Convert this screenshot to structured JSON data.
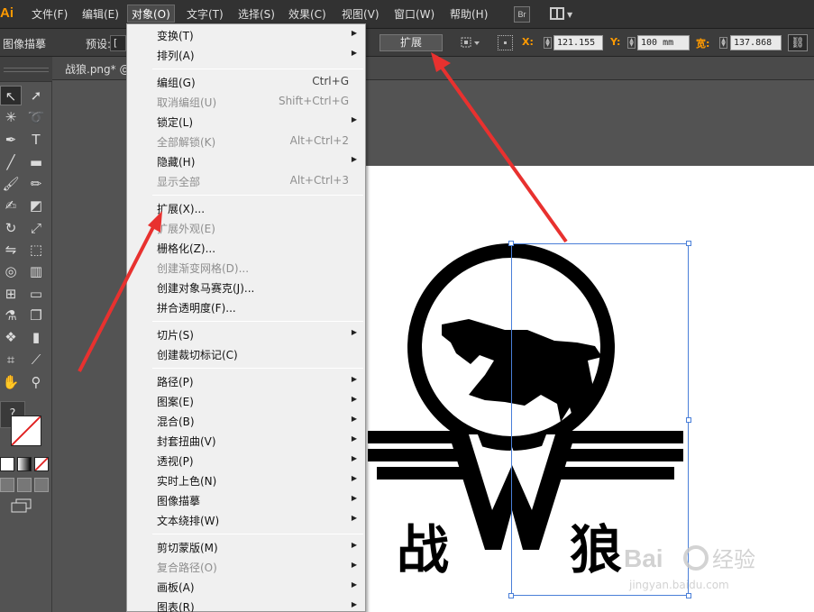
{
  "app": {
    "logo": "Ai",
    "menus": [
      "文件(F)",
      "编辑(E)",
      "对象(O)",
      "文字(T)",
      "选择(S)",
      "效果(C)",
      "视图(V)",
      "窗口(W)",
      "帮助(H)"
    ],
    "active_menu": "对象(O)",
    "bridge_label": "Br",
    "workspace_icon": "workspace-switcher-icon"
  },
  "control_bar": {
    "panel_name": "图像描摹",
    "preset_label": "预设:",
    "preset_value": "[",
    "expand_button": "扩展",
    "x_label": "X:",
    "x_value": "121.155",
    "y_label": "Y:",
    "y_value": "100 mm",
    "w_label": "宽:",
    "w_value": "137.868"
  },
  "document": {
    "tab_title": "战狼.png* @"
  },
  "object_menu": {
    "items": [
      {
        "label": "变换(T)",
        "shortcut": "",
        "submenu": true,
        "disabled": false
      },
      {
        "label": "排列(A)",
        "shortcut": "",
        "submenu": true,
        "disabled": false
      },
      {
        "label": "编组(G)",
        "shortcut": "Ctrl+G",
        "submenu": false,
        "disabled": false
      },
      {
        "label": "取消编组(U)",
        "shortcut": "Shift+Ctrl+G",
        "submenu": false,
        "disabled": true
      },
      {
        "label": "锁定(L)",
        "shortcut": "",
        "submenu": true,
        "disabled": false
      },
      {
        "label": "全部解锁(K)",
        "shortcut": "Alt+Ctrl+2",
        "submenu": false,
        "disabled": true
      },
      {
        "label": "隐藏(H)",
        "shortcut": "",
        "submenu": true,
        "disabled": false
      },
      {
        "label": "显示全部",
        "shortcut": "Alt+Ctrl+3",
        "submenu": false,
        "disabled": true
      },
      {
        "label": "扩展(X)...",
        "shortcut": "",
        "submenu": false,
        "disabled": false
      },
      {
        "label": "扩展外观(E)",
        "shortcut": "",
        "submenu": false,
        "disabled": true
      },
      {
        "label": "栅格化(Z)...",
        "shortcut": "",
        "submenu": false,
        "disabled": false
      },
      {
        "label": "创建渐变网格(D)...",
        "shortcut": "",
        "submenu": false,
        "disabled": true
      },
      {
        "label": "创建对象马赛克(J)...",
        "shortcut": "",
        "submenu": false,
        "disabled": false
      },
      {
        "label": "拼合透明度(F)...",
        "shortcut": "",
        "submenu": false,
        "disabled": false
      },
      {
        "label": "切片(S)",
        "shortcut": "",
        "submenu": true,
        "disabled": false
      },
      {
        "label": "创建裁切标记(C)",
        "shortcut": "",
        "submenu": false,
        "disabled": false
      },
      {
        "label": "路径(P)",
        "shortcut": "",
        "submenu": true,
        "disabled": false
      },
      {
        "label": "图案(E)",
        "shortcut": "",
        "submenu": true,
        "disabled": false
      },
      {
        "label": "混合(B)",
        "shortcut": "",
        "submenu": true,
        "disabled": false
      },
      {
        "label": "封套扭曲(V)",
        "shortcut": "",
        "submenu": true,
        "disabled": false
      },
      {
        "label": "透视(P)",
        "shortcut": "",
        "submenu": true,
        "disabled": false
      },
      {
        "label": "实时上色(N)",
        "shortcut": "",
        "submenu": true,
        "disabled": false
      },
      {
        "label": "图像描摹",
        "shortcut": "",
        "submenu": true,
        "disabled": false
      },
      {
        "label": "文本绕排(W)",
        "shortcut": "",
        "submenu": true,
        "disabled": false
      },
      {
        "label": "剪切蒙版(M)",
        "shortcut": "",
        "submenu": true,
        "disabled": false
      },
      {
        "label": "复合路径(O)",
        "shortcut": "",
        "submenu": true,
        "disabled": true
      },
      {
        "label": "画板(A)",
        "shortcut": "",
        "submenu": true,
        "disabled": false
      },
      {
        "label": "图表(R)",
        "shortcut": "",
        "submenu": true,
        "disabled": false
      }
    ]
  },
  "tools": {
    "help_label": "?",
    "icons": [
      "selection-tool-icon",
      "direct-selection-tool-icon",
      "magic-wand-tool-icon",
      "lasso-tool-icon",
      "pen-tool-icon",
      "type-tool-icon",
      "line-tool-icon",
      "rectangle-tool-icon",
      "paintbrush-tool-icon",
      "pencil-tool-icon",
      "blob-brush-tool-icon",
      "eraser-tool-icon",
      "rotate-tool-icon",
      "scale-tool-icon",
      "width-tool-icon",
      "free-transform-tool-icon",
      "shape-builder-tool-icon",
      "perspective-grid-tool-icon",
      "mesh-tool-icon",
      "gradient-tool-icon",
      "eyedropper-tool-icon",
      "blend-tool-icon",
      "symbol-sprayer-tool-icon",
      "column-graph-tool-icon",
      "artboard-tool-icon",
      "slice-tool-icon",
      "hand-tool-icon",
      "zoom-tool-icon"
    ]
  },
  "artwork": {
    "title_left": "战",
    "title_right": "狼"
  },
  "watermark": {
    "brand": "Bai",
    "brand_cn": "经验",
    "url": "jingyan.baidu.com"
  },
  "colors": {
    "accent": "#ff9a00",
    "annotation_arrow": "#e8312f",
    "selection": "#4a7fd8"
  }
}
